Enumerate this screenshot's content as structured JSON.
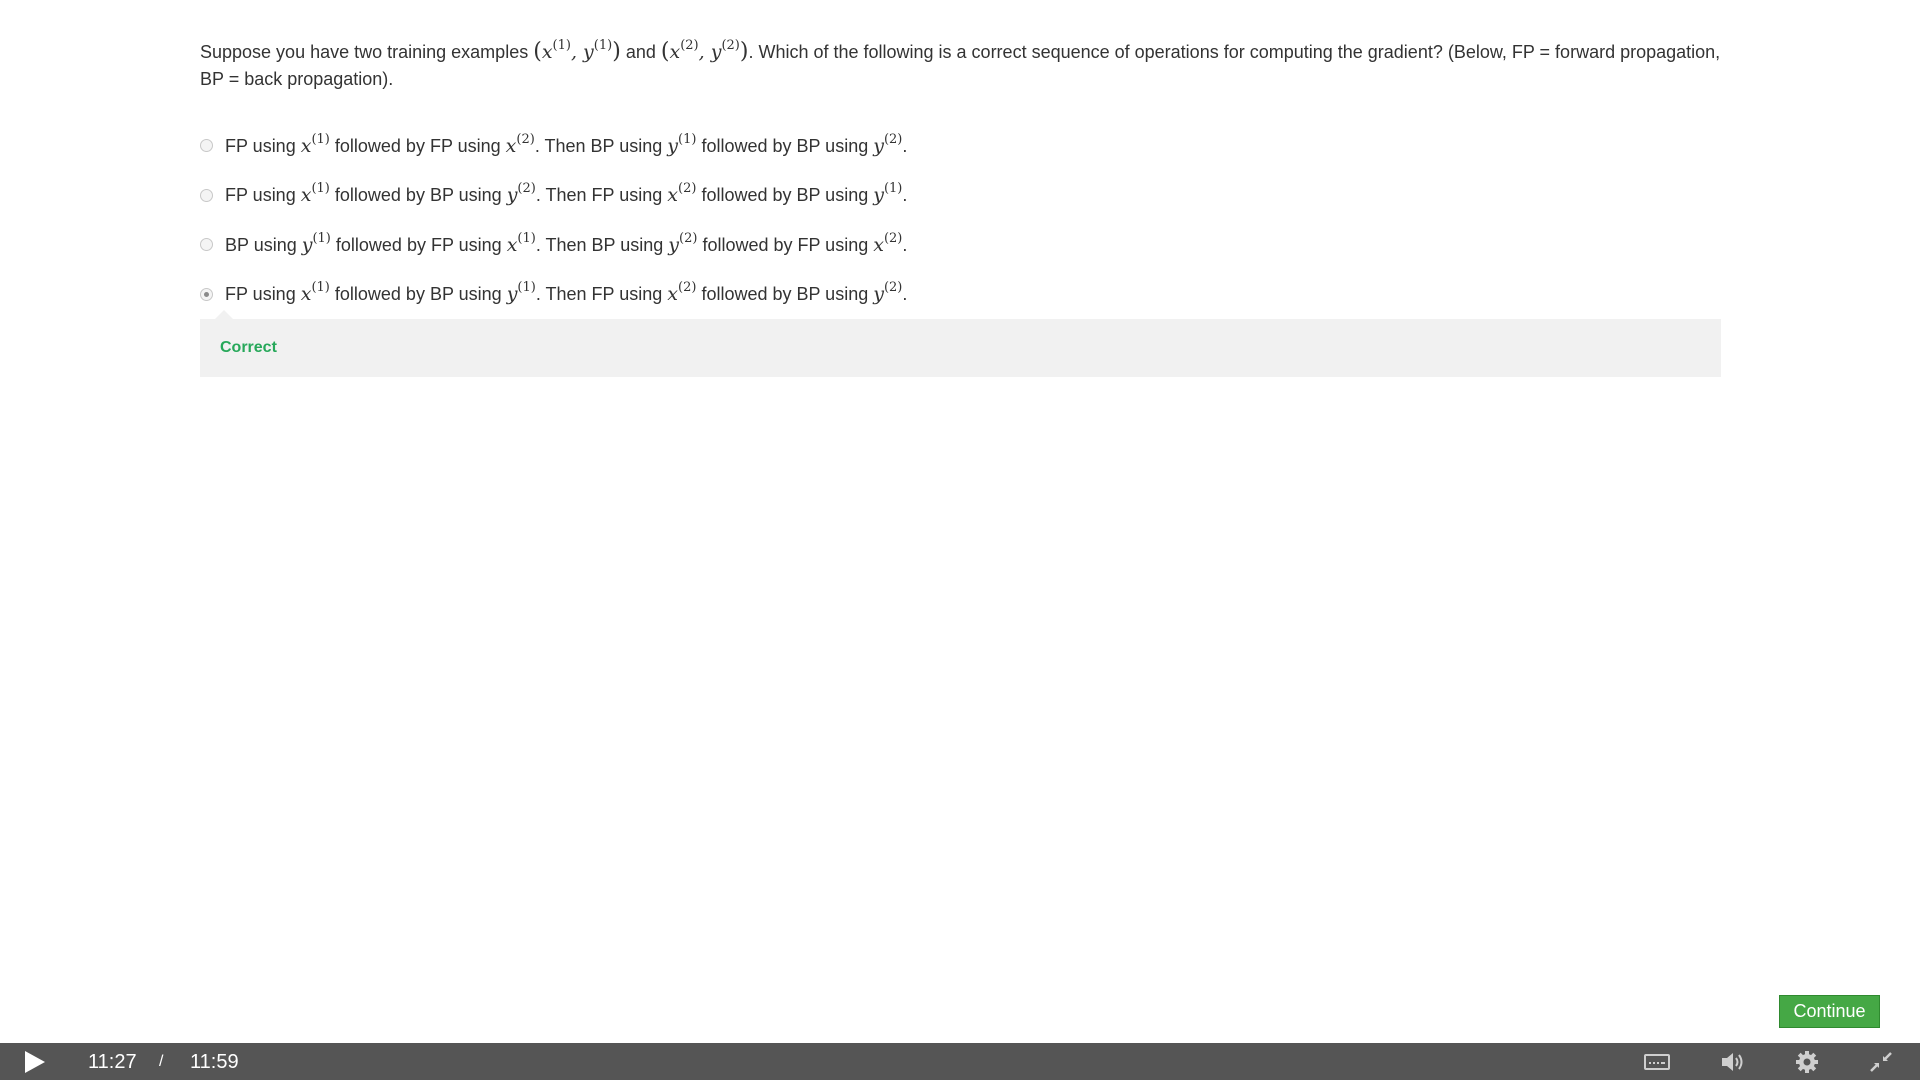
{
  "question": {
    "intro": "Suppose you have two training examples",
    "and": "and",
    "rest": ". Which of the following is a correct sequence of operations for computing the gradient? (Below, FP = forward propagation, BP = back propagation)."
  },
  "math": {
    "x": "x",
    "y": "y",
    "one": "(1)",
    "two": "(2)",
    "lparen": "(",
    "rparen": ")",
    "comma": ","
  },
  "words": {
    "fp_using": "FP using",
    "bp_using": "BP using",
    "followed_fp": "followed by FP using",
    "followed_bp": "followed by BP using",
    "then_bp": ". Then BP using",
    "then_fp": ". Then FP using",
    "period": "."
  },
  "options": [
    {
      "selected": false
    },
    {
      "selected": false
    },
    {
      "selected": false
    },
    {
      "selected": true
    }
  ],
  "feedback": {
    "label": "Correct",
    "color": "#27a85a"
  },
  "continue_button": {
    "label": "Continue",
    "color": "#45a845"
  },
  "player": {
    "current_time": "11:27",
    "separator": "/",
    "total_time": "11:59",
    "icons": [
      "play-icon",
      "captions-icon",
      "volume-icon",
      "settings-gear-icon",
      "exit-fullscreen-icon"
    ],
    "bar_color": "#555555"
  }
}
